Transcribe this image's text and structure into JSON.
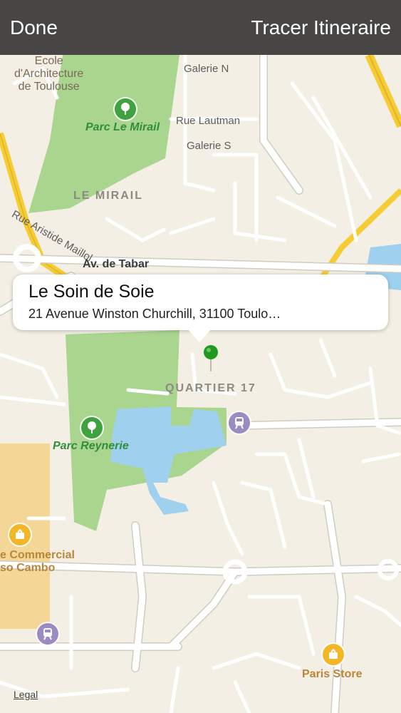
{
  "navbar": {
    "done_label": "Done",
    "route_label": "Tracer Itineraire"
  },
  "callout": {
    "title": "Le Soin de Soie",
    "subtitle": "21 Avenue Winston Churchill, 31100 Toulo…"
  },
  "map": {
    "school_label_line1": "Ecole",
    "school_label_line2": "d'Architecture",
    "school_label_line3": "de Toulouse",
    "park_le_mirail": "Parc Le Mirail",
    "district_le_mirail": "LE MIRAIL",
    "district_quartier_17": "QUARTIER 17",
    "park_reynerie": "Parc Reynerie",
    "street_galerie_n": "Galerie N",
    "street_rue_lautman": "Rue Lautman",
    "street_galerie_s": "Galerie S",
    "street_rue_aristide_maillol": "Rue Aristide Maillol",
    "street_av_de_tabar": "Av. de Tabar",
    "commercial_line1": "e Commercial",
    "commercial_line2": "so Cambo",
    "paris_store": "Paris Store",
    "legal": "Legal"
  },
  "icons": {
    "park": "tree-icon",
    "tram": "tram-icon",
    "shopping": "shopping-basket-icon",
    "pin": "map-pin-icon"
  },
  "colors": {
    "navbar_bg": "#474644",
    "map_bg": "#f3efe4",
    "park": "#a9d58f",
    "water": "#9fd0ee",
    "commercial": "#f4d696",
    "highway": "#f6cc34",
    "pin": "#1f9a1f"
  }
}
